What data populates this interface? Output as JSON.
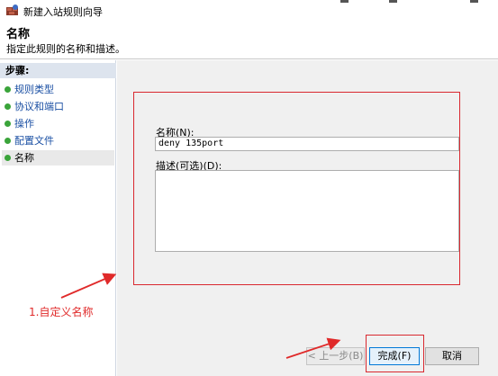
{
  "window": {
    "title": "新建入站规则向导",
    "icon": "firewall-wizard-icon"
  },
  "header": {
    "title": "名称",
    "subtitle": "指定此规则的名称和描述。"
  },
  "steps": {
    "heading": "步骤:",
    "items": [
      {
        "label": "规则类型",
        "current": false
      },
      {
        "label": "协议和端口",
        "current": false
      },
      {
        "label": "操作",
        "current": false
      },
      {
        "label": "配置文件",
        "current": false
      },
      {
        "label": "名称",
        "current": true
      }
    ]
  },
  "form": {
    "name_label": "名称(N):",
    "name_value": "deny 135port",
    "description_label": "描述(可选)(D):",
    "description_value": ""
  },
  "buttons": {
    "back": "< 上一步(B)",
    "finish": "完成(F)",
    "cancel": "取消"
  },
  "annotation": {
    "text": "1.自定义名称",
    "color": "#e02a2a"
  },
  "colors": {
    "highlight_box": "#d9282f",
    "step_link": "#1a4fa3",
    "step_dot": "#3aa43a",
    "focus_border": "#0078d7"
  }
}
